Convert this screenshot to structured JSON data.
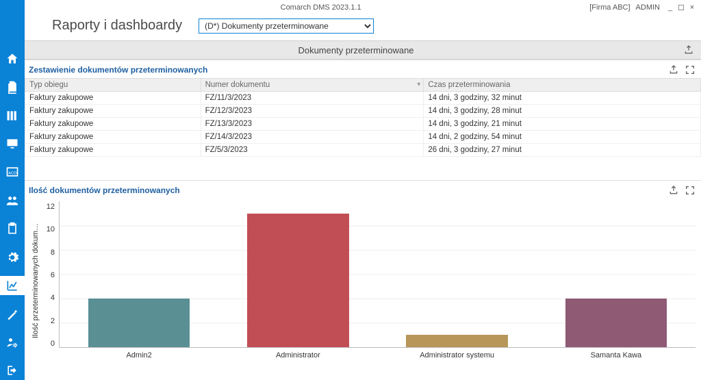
{
  "app": {
    "title": "Comarch DMS 2023.1.1",
    "company": "[Firma ABC]",
    "user": "ADMIN"
  },
  "header": {
    "page_title": "Raporty i dashboardy",
    "report_selected": "(D*) Dokumenty przeterminowane"
  },
  "group": {
    "title": "Dokumenty przeterminowane"
  },
  "table_panel": {
    "title": "Zestawienie dokumentów przeterminowanych",
    "columns": {
      "type": "Typ obiegu",
      "number": "Numer dokumentu",
      "delay": "Czas przeterminowania"
    },
    "rows": [
      {
        "type": "Faktury zakupowe",
        "number": "FZ/11/3/2023",
        "delay": "14 dni, 3 godziny, 32 minut"
      },
      {
        "type": "Faktury zakupowe",
        "number": "FZ/12/3/2023",
        "delay": "14 dni, 3 godziny, 28 minut"
      },
      {
        "type": "Faktury zakupowe",
        "number": "FZ/13/3/2023",
        "delay": "14 dni, 3 godziny, 21 minut"
      },
      {
        "type": "Faktury zakupowe",
        "number": "FZ/14/3/2023",
        "delay": "14 dni, 2 godziny, 54 minut"
      },
      {
        "type": "Faktury zakupowe",
        "number": "FZ/5/3/2023",
        "delay": "26 dni, 3 godziny, 27 minut"
      }
    ]
  },
  "chart_panel": {
    "title": "Ilość dokumentów przeterminowanych"
  },
  "chart_data": {
    "type": "bar",
    "title": "Ilość dokumentów przeterminowanych",
    "ylabel": "Ilość przeterminowanych dokum…",
    "xlabel": "",
    "ylim": [
      0,
      12
    ],
    "yticks": [
      12,
      10,
      8,
      6,
      4,
      2,
      0
    ],
    "categories": [
      "Admin2",
      "Administrator",
      "Administrator systemu",
      "Samanta Kawa"
    ],
    "values": [
      4,
      11,
      1,
      4
    ],
    "colors": [
      "#5a8f94",
      "#c24e55",
      "#b8965a",
      "#8f5a73"
    ]
  },
  "icons": {
    "home": "home-icon",
    "documents": "documents-icon",
    "books": "books-icon",
    "monitor": "monitor-icon",
    "acd": "acd-icon",
    "users": "users-icon",
    "clipboard": "clipboard-icon",
    "gear": "gear-icon",
    "chart": "chart-icon",
    "wand": "wand-icon",
    "person_gear": "person-gear-icon",
    "exit": "exit-icon"
  }
}
